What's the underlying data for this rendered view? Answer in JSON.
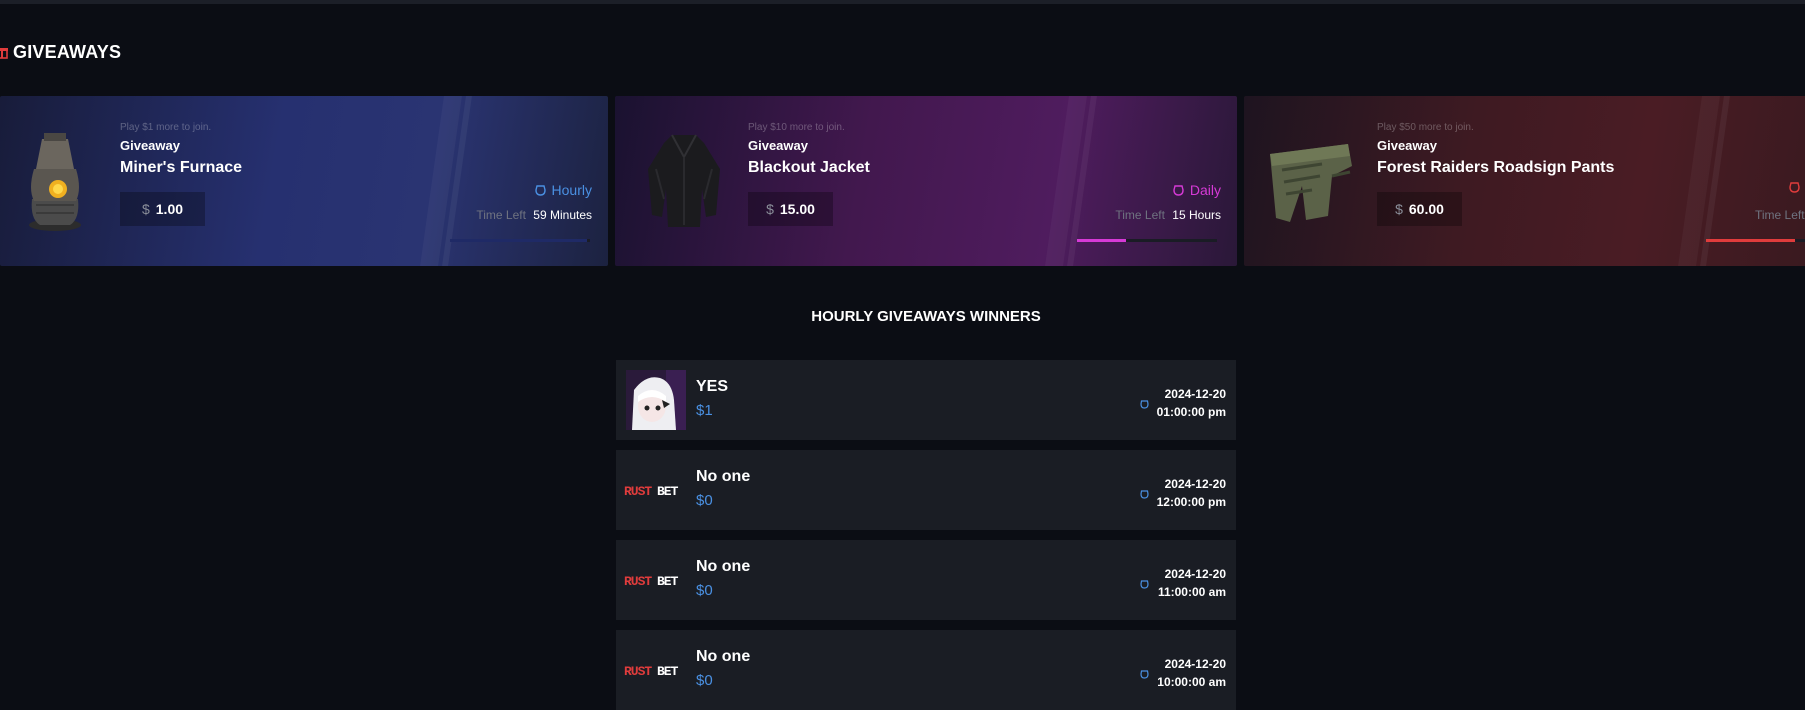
{
  "section": {
    "title": "GIVEAWAYS"
  },
  "giveaways": [
    {
      "requirement": "Play $1 more to join.",
      "label": "Giveaway",
      "item": "Miner's Furnace",
      "currency": "$",
      "price": "1.00",
      "frequency": "Hourly",
      "time_left_label": "Time Left",
      "time_left": "59 Minutes",
      "accent": "#4a90e2",
      "progress": 0.98
    },
    {
      "requirement": "Play $10 more to join.",
      "label": "Giveaway",
      "item": "Blackout Jacket",
      "currency": "$",
      "price": "15.00",
      "frequency": "Daily",
      "time_left_label": "Time Left",
      "time_left": "15 Hours",
      "accent": "#d63ad6",
      "progress": 0.35
    },
    {
      "requirement": "Play $50 more to join.",
      "label": "Giveaway",
      "item": "Forest Raiders Roadsign Pants",
      "currency": "$",
      "price": "60.00",
      "frequency": "",
      "time_left_label": "Time Left",
      "time_left": "",
      "accent": "#e03c3c",
      "progress": 0.9
    }
  ],
  "winners": {
    "title": "HOURLY GIVEAWAYS WINNERS",
    "rows": [
      {
        "name": "YES",
        "amount": "$1",
        "date": "2024-12-20",
        "time": "01:00:00 pm",
        "avatar": "anime-avatar"
      },
      {
        "name": "No one",
        "amount": "$0",
        "date": "2024-12-20",
        "time": "12:00:00 pm",
        "avatar": "rustbet-logo"
      },
      {
        "name": "No one",
        "amount": "$0",
        "date": "2024-12-20",
        "time": "11:00:00 am",
        "avatar": "rustbet-logo"
      },
      {
        "name": "No one",
        "amount": "$0",
        "date": "2024-12-20",
        "time": "10:00:00 am",
        "avatar": "rustbet-logo"
      }
    ]
  },
  "colors": {
    "hourly": "#4a90e2",
    "daily": "#d63ad6",
    "monthly": "#e03c3c",
    "amount": "#4a90e2",
    "brand_red": "#e03c3c"
  }
}
